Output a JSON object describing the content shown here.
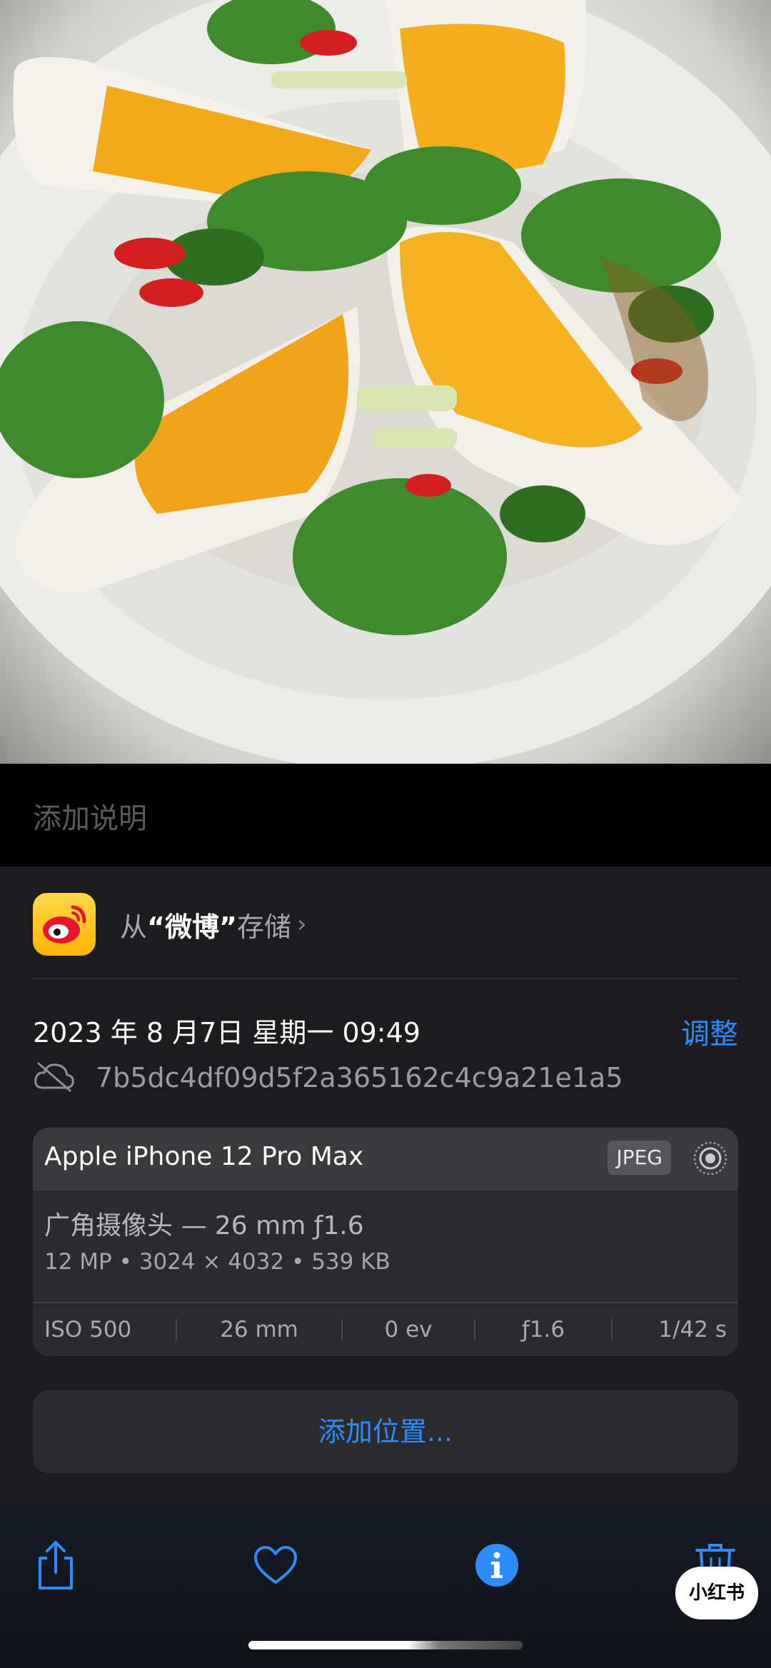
{
  "photo": {
    "subject": "photo-preview"
  },
  "caption": {
    "placeholder": "添加说明"
  },
  "source": {
    "prefix": "从",
    "app_name": "“微博”",
    "suffix": "存储",
    "chevron": "›",
    "icon": "weibo-app-icon"
  },
  "datetime": {
    "text": "2023 年 8 月7日 星期一 09:49",
    "adjust_label": "调整"
  },
  "file": {
    "hash": "7b5dc4df09d5f2a365162c4c9a21e1a5",
    "icon": "cloud-slash-icon"
  },
  "camera": {
    "device": "Apple iPhone 12 Pro Max",
    "format": "JPEG",
    "lens": "广角摄像头 — 26 mm ƒ1.6",
    "specs": "12 MP • 3024 × 4032 • 539 KB",
    "exif": [
      "ISO 500",
      "26 mm",
      "0 ev",
      "ƒ1.6",
      "1/42 s"
    ]
  },
  "location": {
    "add_label": "添加位置..."
  },
  "toolbar": {
    "items": [
      "share-icon",
      "heart-icon",
      "info-icon",
      "trash-icon"
    ]
  },
  "watermark": {
    "text": "小红书"
  },
  "colors": {
    "accent": "#2f8bff",
    "panel": "#1c1c1e",
    "card": "#2b2b2e"
  }
}
